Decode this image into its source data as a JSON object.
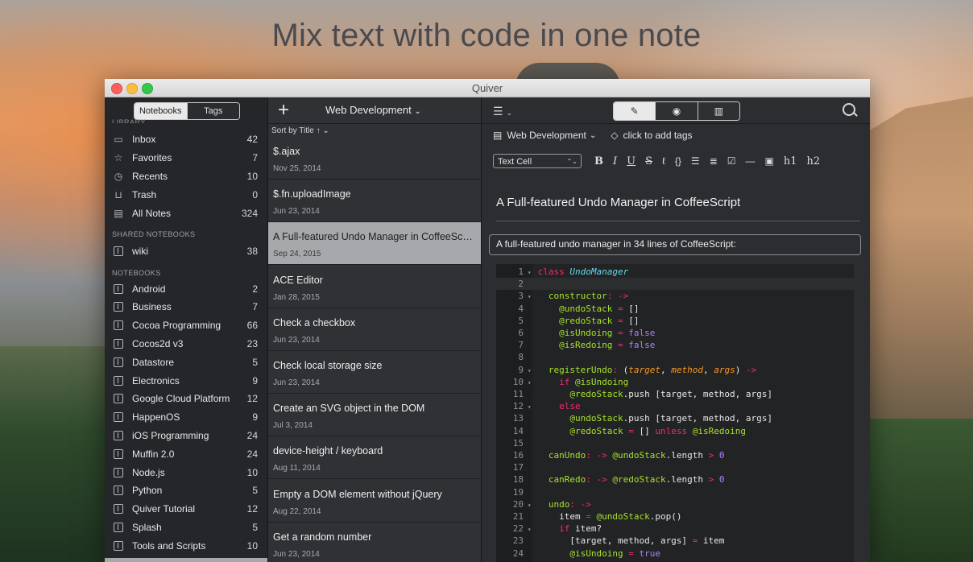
{
  "headline": "Mix text with code in one note",
  "window": {
    "title": "Quiver"
  },
  "sidebar": {
    "tabs": {
      "notebooks": "Notebooks",
      "tags": "Tags"
    },
    "cut_label": "LIBRARY",
    "library": [
      {
        "label": "Inbox",
        "count": "42",
        "icon": "inbox-icon"
      },
      {
        "label": "Favorites",
        "count": "7",
        "icon": "star-icon"
      },
      {
        "label": "Recents",
        "count": "10",
        "icon": "clock-icon"
      },
      {
        "label": "Trash",
        "count": "0",
        "icon": "trash-icon"
      },
      {
        "label": "All Notes",
        "count": "324",
        "icon": "all-notes-icon"
      }
    ],
    "shared_header": "SHARED NOTEBOOKS",
    "shared": [
      {
        "label": "wiki",
        "count": "38"
      }
    ],
    "notebooks_header": "NOTEBOOKS",
    "notebooks": [
      {
        "label": "Android",
        "count": "2"
      },
      {
        "label": "Business",
        "count": "7"
      },
      {
        "label": "Cocoa Programming",
        "count": "66"
      },
      {
        "label": "Cocos2d v3",
        "count": "23"
      },
      {
        "label": "Datastore",
        "count": "5"
      },
      {
        "label": "Electronics",
        "count": "9"
      },
      {
        "label": "Google Cloud Platform",
        "count": "12"
      },
      {
        "label": "HappenOS",
        "count": "9"
      },
      {
        "label": "iOS Programming",
        "count": "24"
      },
      {
        "label": "Muffin 2.0",
        "count": "24"
      },
      {
        "label": "Node.js",
        "count": "10"
      },
      {
        "label": "Python",
        "count": "5"
      },
      {
        "label": "Quiver Tutorial",
        "count": "12"
      },
      {
        "label": "Splash",
        "count": "5"
      },
      {
        "label": "Tools and Scripts",
        "count": "10"
      }
    ]
  },
  "notelist": {
    "notebook_title": "Web Development",
    "sort_label": "Sort by Title ↑",
    "notes": [
      {
        "title": "$.ajax",
        "date": "Nov 25, 2014"
      },
      {
        "title": "$.fn.uploadImage",
        "date": "Jun 23, 2014"
      },
      {
        "title": "A Full-featured Undo Manager in CoffeeScript",
        "date": "Sep 24, 2015",
        "selected": true
      },
      {
        "title": "ACE Editor",
        "date": "Jan 28, 2015"
      },
      {
        "title": "Check a checkbox",
        "date": "Jun 23, 2014"
      },
      {
        "title": "Check local storage size",
        "date": "Jun 23, 2014"
      },
      {
        "title": "Create an SVG object in the DOM",
        "date": "Jul 3, 2014"
      },
      {
        "title": "device-height / keyboard",
        "date": "Aug 11, 2014"
      },
      {
        "title": "Empty a DOM element without jQuery",
        "date": "Aug 22, 2014"
      },
      {
        "title": "Get a random number",
        "date": "Jun 23, 2014"
      }
    ]
  },
  "editor": {
    "notebook": "Web Development",
    "tags_placeholder": "click to add tags",
    "cell_type": "Text Cell",
    "format_buttons": [
      {
        "label": "B",
        "name": "bold-button"
      },
      {
        "label": "I",
        "name": "italic-button"
      },
      {
        "label": "U",
        "name": "underline-button"
      },
      {
        "label": "S",
        "name": "strikethrough-button"
      },
      {
        "label": "ℓ",
        "name": "highlight-button"
      },
      {
        "label": "{}",
        "name": "code-button"
      },
      {
        "label": "☰",
        "name": "bullet-list-button"
      },
      {
        "label": "≣",
        "name": "numbered-list-button"
      },
      {
        "label": "☑",
        "name": "checklist-button"
      },
      {
        "label": "—",
        "name": "horizontal-rule-button"
      },
      {
        "label": "▣",
        "name": "image-button"
      },
      {
        "label": "h1",
        "name": "heading1-button"
      },
      {
        "label": "h2",
        "name": "heading2-button"
      }
    ],
    "note_title": "A Full-featured Undo Manager in CoffeeScript",
    "text_cell": "A full-featured undo manager in 34 lines of CoffeeScript:",
    "code_lines": [
      {
        "n": "1",
        "fold": "▾",
        "html": "<span class='k'>class</span> <span class='c'>UndoManager</span>"
      },
      {
        "n": "2",
        "fold": "",
        "html": ""
      },
      {
        "n": "3",
        "fold": "▾",
        "html": "  <span class='v'>constructor</span><span class='k'>:</span> <span class='k'>-></span>"
      },
      {
        "n": "4",
        "fold": "",
        "html": "    <span class='v'>@undoStack</span> <span class='k'>=</span> []"
      },
      {
        "n": "5",
        "fold": "",
        "html": "    <span class='v'>@redoStack</span> <span class='k'>=</span> []"
      },
      {
        "n": "6",
        "fold": "",
        "html": "    <span class='v'>@isUndoing</span> <span class='k'>=</span> <span class='p'>false</span>"
      },
      {
        "n": "7",
        "fold": "",
        "html": "    <span class='v'>@isRedoing</span> <span class='k'>=</span> <span class='p'>false</span>"
      },
      {
        "n": "8",
        "fold": "",
        "html": ""
      },
      {
        "n": "9",
        "fold": "▾",
        "html": "  <span class='v'>registerUndo</span><span class='k'>:</span> (<span class='a'>target</span>, <span class='a'>method</span>, <span class='a'>args</span>) <span class='k'>-></span>"
      },
      {
        "n": "10",
        "fold": "▾",
        "html": "    <span class='k'>if</span> <span class='v'>@isUndoing</span>"
      },
      {
        "n": "11",
        "fold": "",
        "html": "      <span class='v'>@redoStack</span>.push [target, method, args]"
      },
      {
        "n": "12",
        "fold": "▾",
        "html": "    <span class='k'>else</span>"
      },
      {
        "n": "13",
        "fold": "",
        "html": "      <span class='v'>@undoStack</span>.push [target, method, args]"
      },
      {
        "n": "14",
        "fold": "",
        "html": "      <span class='v'>@redoStack</span> <span class='k'>=</span> [] <span class='k'>unless</span> <span class='v'>@isRedoing</span>"
      },
      {
        "n": "15",
        "fold": "",
        "html": ""
      },
      {
        "n": "16",
        "fold": "",
        "html": "  <span class='v'>canUndo</span><span class='k'>:</span> <span class='k'>-></span> <span class='v'>@undoStack</span>.length <span class='k'>></span> <span class='p'>0</span>"
      },
      {
        "n": "17",
        "fold": "",
        "html": ""
      },
      {
        "n": "18",
        "fold": "",
        "html": "  <span class='v'>canRedo</span><span class='k'>:</span> <span class='k'>-></span> <span class='v'>@redoStack</span>.length <span class='k'>></span> <span class='p'>0</span>"
      },
      {
        "n": "19",
        "fold": "",
        "html": ""
      },
      {
        "n": "20",
        "fold": "▾",
        "html": "  <span class='v'>undo</span><span class='k'>:</span> <span class='k'>-></span>"
      },
      {
        "n": "21",
        "fold": "",
        "html": "    item <span class='k'>=</span> <span class='v'>@undoStack</span>.pop()"
      },
      {
        "n": "22",
        "fold": "▾",
        "html": "    <span class='k'>if</span> item?"
      },
      {
        "n": "23",
        "fold": "",
        "html": "      [target, method, args] <span class='k'>=</span> item"
      },
      {
        "n": "24",
        "fold": "",
        "html": "      <span class='v'>@isUndoing</span> <span class='k'>=</span> <span class='p'>true</span>"
      }
    ]
  }
}
